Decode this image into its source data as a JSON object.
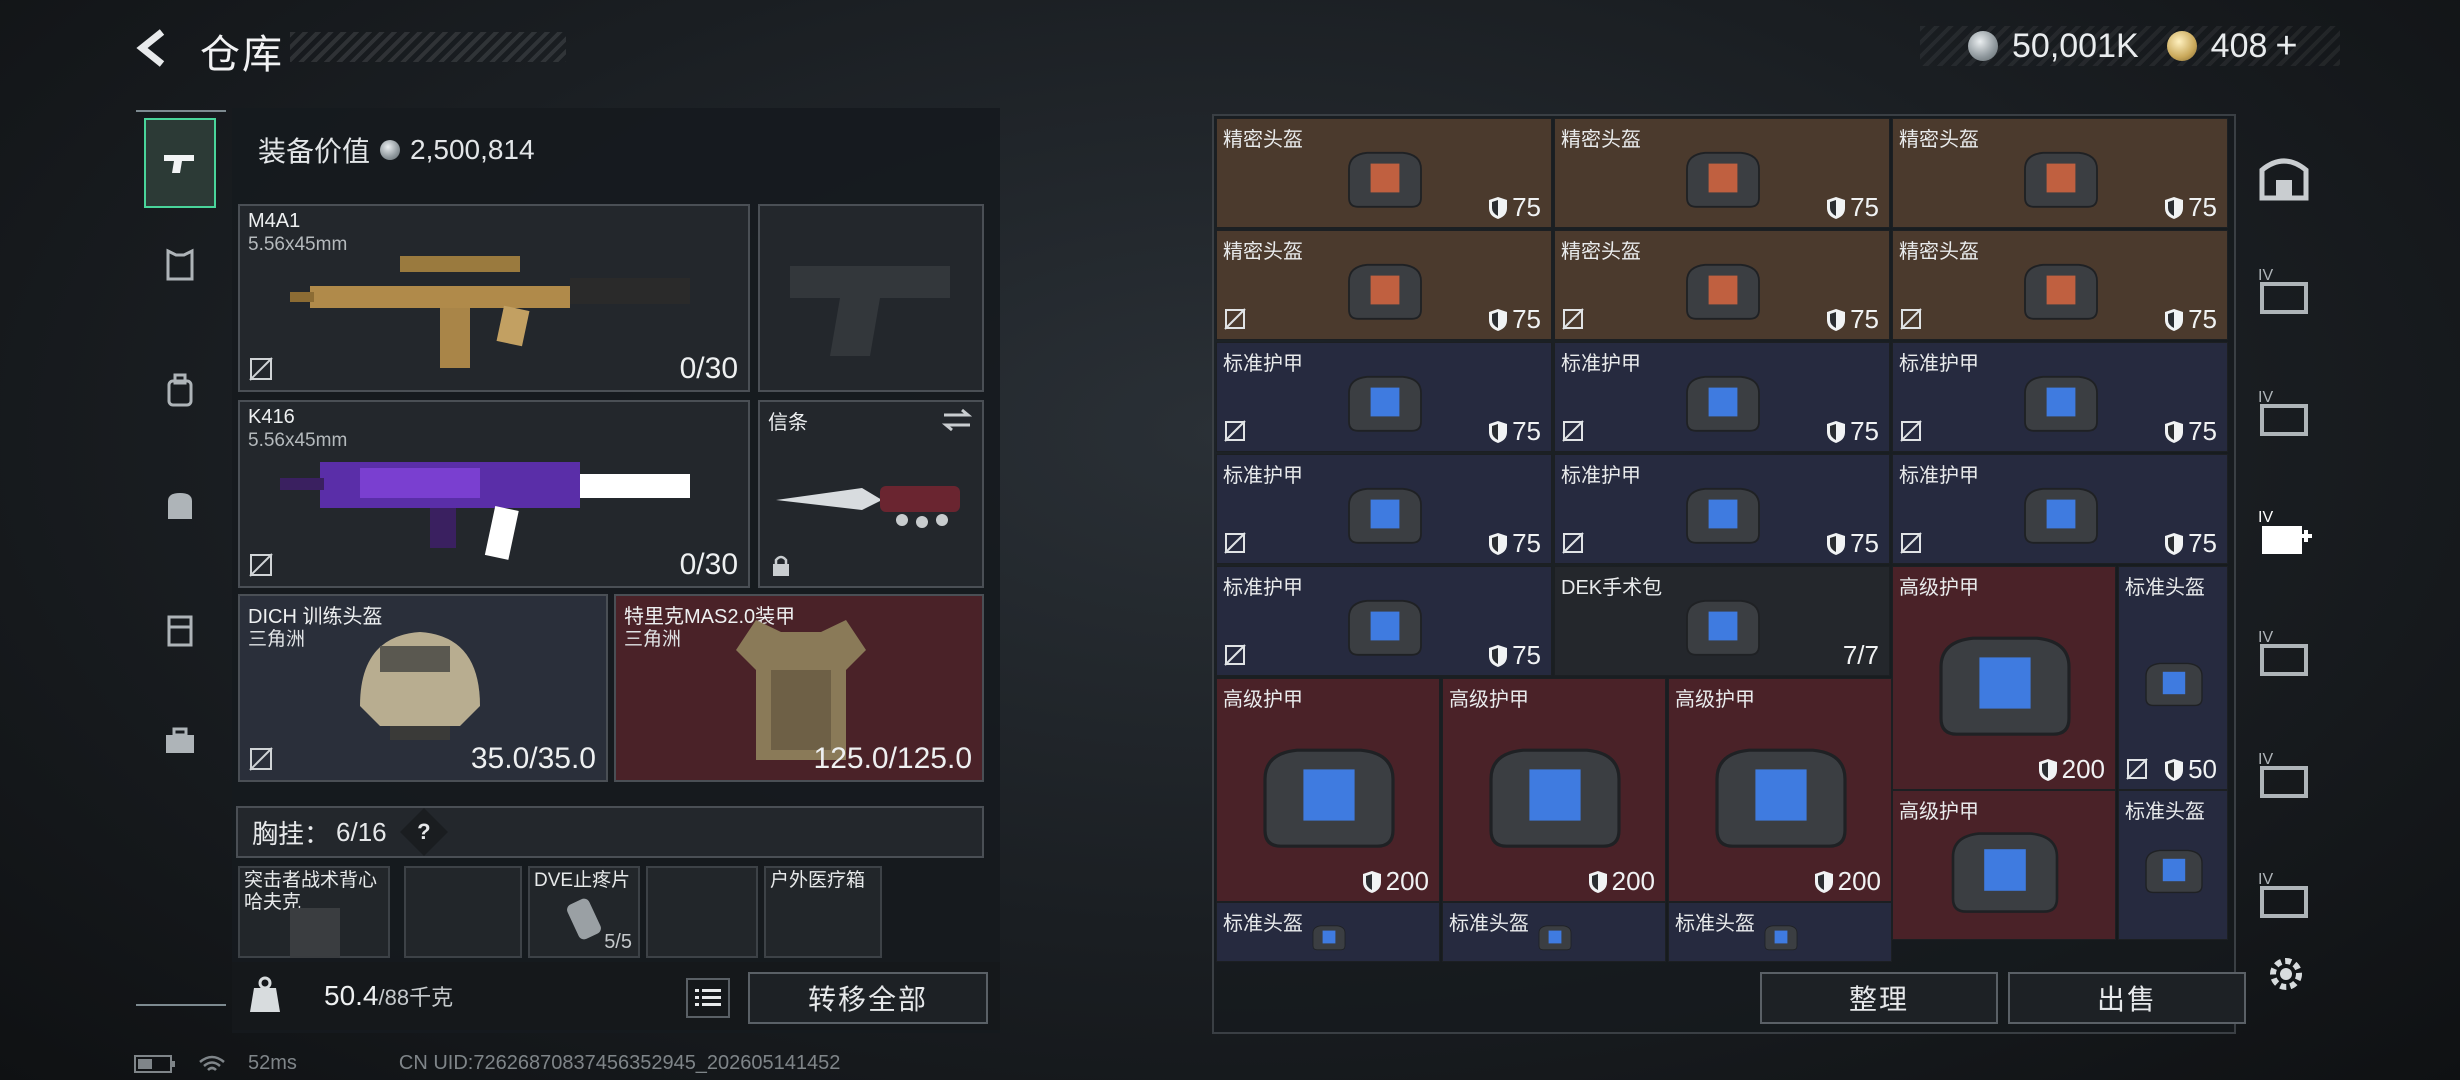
{
  "header": {
    "title": "仓库",
    "currency_silver": "50,001K",
    "currency_gold": "408",
    "add_label": "+"
  },
  "left_panel": {
    "equip_value_label": "装备价值",
    "equip_value": "2,500,814",
    "primary_weapon": {
      "name": "M4A1",
      "caliber": "5.56x45mm",
      "ammo": "0/30"
    },
    "secondary_weapon": {
      "name": "K416",
      "caliber": "5.56x45mm",
      "ammo": "0/30"
    },
    "melee": {
      "name": "信条"
    },
    "helmet": {
      "name": "DICH 训练头盔",
      "faction": "三角洲",
      "durability": "35.0/35.0"
    },
    "armor": {
      "name": "特里克MAS2.0装甲",
      "faction": "三角洲",
      "durability": "125.0/125.0"
    },
    "chest_rig_label": "胸挂：",
    "chest_rig_count": "6/16",
    "chest_slots": [
      {
        "name": "突击者战术背心",
        "sub": "哈夫克"
      },
      {
        "name": "",
        "sub": ""
      },
      {
        "name": "DVE止疼片",
        "sub": "5/5"
      },
      {
        "name": "",
        "sub": ""
      },
      {
        "name": "户外医疗箱",
        "sub": ""
      }
    ],
    "weight": "50.4",
    "weight_max": "/88千克",
    "transfer_all": "转移全部"
  },
  "stash": {
    "cells": [
      {
        "label": "精密头盔",
        "value": "75",
        "color": "brown",
        "noins": false
      },
      {
        "label": "精密头盔",
        "value": "75",
        "color": "brown",
        "noins": false
      },
      {
        "label": "精密头盔",
        "value": "75",
        "color": "brown",
        "noins": false
      },
      {
        "label": "精密头盔",
        "value": "75",
        "color": "brown",
        "noins": true
      },
      {
        "label": "精密头盔",
        "value": "75",
        "color": "brown",
        "noins": true
      },
      {
        "label": "精密头盔",
        "value": "75",
        "color": "brown",
        "noins": true
      },
      {
        "label": "标准护甲",
        "value": "75",
        "color": "navy",
        "noins": true
      },
      {
        "label": "标准护甲",
        "value": "75",
        "color": "navy",
        "noins": true
      },
      {
        "label": "标准护甲",
        "value": "75",
        "color": "navy",
        "noins": true
      },
      {
        "label": "标准护甲",
        "value": "75",
        "color": "navy",
        "noins": true
      },
      {
        "label": "标准护甲",
        "value": "75",
        "color": "navy",
        "noins": true
      },
      {
        "label": "标准护甲",
        "value": "75",
        "color": "navy",
        "noins": true
      },
      {
        "label": "标准护甲",
        "value": "75",
        "color": "navy",
        "noins": true
      },
      {
        "label": "DEK手术包",
        "value": "7/7",
        "color": "dark",
        "noins": false
      },
      {
        "label": "高级护甲",
        "value": "200",
        "color": "red",
        "noins": false
      },
      {
        "label": "标准头盔",
        "value": "50",
        "color": "navy",
        "noins": true
      },
      {
        "label": "高级护甲",
        "value": "200",
        "color": "red",
        "noins": false
      },
      {
        "label": "高级护甲",
        "value": "200",
        "color": "red",
        "noins": false
      },
      {
        "label": "高级护甲",
        "value": "200",
        "color": "red",
        "noins": false
      },
      {
        "label": "高级护甲",
        "value": "",
        "color": "red",
        "noins": false
      },
      {
        "label": "标准头盔",
        "value": "",
        "color": "navy",
        "noins": false
      },
      {
        "label": "标准头盔",
        "value": "",
        "color": "navy",
        "noins": false
      },
      {
        "label": "标准头盔",
        "value": "",
        "color": "navy",
        "noins": false
      },
      {
        "label": "标准头盔",
        "value": "",
        "color": "navy",
        "noins": false
      }
    ],
    "sort_label": "整理",
    "sell_label": "出售"
  },
  "footer": {
    "ping": "52ms",
    "uid": "CN UID:72626870837456352945_202605141452"
  },
  "colors": {
    "accent_green": "#49d49a",
    "brown_cell": "#4b3a2d",
    "navy_cell": "#262a3f",
    "red_cell": "#4a2228"
  }
}
